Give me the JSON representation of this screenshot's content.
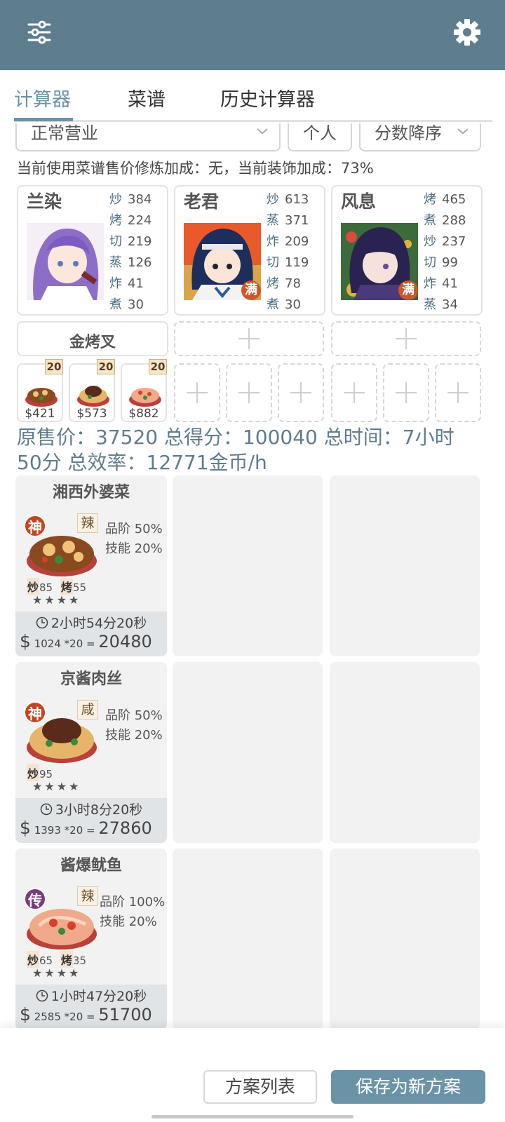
{
  "header": {
    "menu_icon": "sliders-icon",
    "settings_icon": "gear-icon",
    "bg_color": "#5e7d8f"
  },
  "tabs": [
    {
      "label": "计算器",
      "active": true
    },
    {
      "label": "菜谱",
      "active": false
    },
    {
      "label": "历史计算器",
      "active": false
    }
  ],
  "filters": {
    "mode": "正常营业",
    "scope": "个人",
    "sort": "分数降序"
  },
  "bonus_note": "当前使用菜谱售价修炼加成：无，当前装饰加成：73%",
  "chefs": [
    {
      "name": "兰染",
      "full": false,
      "full_label": "",
      "skills": [
        {
          "k": "炒",
          "v": "384"
        },
        {
          "k": "烤",
          "v": "224"
        },
        {
          "k": "切",
          "v": "219"
        },
        {
          "k": "蒸",
          "v": "126"
        },
        {
          "k": "炸",
          "v": "41"
        },
        {
          "k": "煮",
          "v": "30"
        }
      ]
    },
    {
      "name": "老君",
      "full": true,
      "full_label": "满",
      "skills": [
        {
          "k": "炒",
          "v": "613"
        },
        {
          "k": "蒸",
          "v": "371"
        },
        {
          "k": "炸",
          "v": "209"
        },
        {
          "k": "切",
          "v": "119"
        },
        {
          "k": "烤",
          "v": "78"
        },
        {
          "k": "煮",
          "v": "30"
        }
      ]
    },
    {
      "name": "风息",
      "full": true,
      "full_label": "满",
      "skills": [
        {
          "k": "烤",
          "v": "465"
        },
        {
          "k": "煮",
          "v": "288"
        },
        {
          "k": "炒",
          "v": "237"
        },
        {
          "k": "切",
          "v": "99"
        },
        {
          "k": "炸",
          "v": "41"
        },
        {
          "k": "蒸",
          "v": "34"
        }
      ]
    }
  ],
  "equipment": {
    "label": "金烤叉"
  },
  "dish_slots": [
    {
      "qty": "20",
      "price": "$421"
    },
    {
      "qty": "20",
      "price": "$573"
    },
    {
      "qty": "20",
      "price": "$882"
    }
  ],
  "summary": {
    "line1": "原售价：37520 总得分：100040 总时间：7小时",
    "line2": "50分 总效率：12771金币/h"
  },
  "recipes": [
    {
      "name": "湘西外婆菜",
      "rarity": "神",
      "rarity_color": "#c2471f",
      "taste": "辣",
      "quality": "品阶 50%",
      "skill": "技能 20%",
      "req": [
        {
          "k": "炒",
          "v": "85"
        },
        {
          "k": "烤",
          "v": "55"
        }
      ],
      "stars": "★★★★",
      "time": "2小时54分20秒",
      "unit": "1024",
      "count": "*20",
      "eq": "=",
      "total": "20480"
    },
    {
      "name": "京酱肉丝",
      "rarity": "神",
      "rarity_color": "#c2471f",
      "taste": "咸",
      "quality": "品阶 50%",
      "skill": "技能 20%",
      "req": [
        {
          "k": "炒",
          "v": "95"
        }
      ],
      "stars": "★★★★",
      "time": "3小时8分20秒",
      "unit": "1393",
      "count": "*20",
      "eq": "=",
      "total": "27860"
    },
    {
      "name": "酱爆鱿鱼",
      "rarity": "传",
      "rarity_color": "#7a3b7e",
      "taste": "辣",
      "quality": "品阶 100%",
      "skill": "技能 20%",
      "req": [
        {
          "k": "炒",
          "v": "65"
        },
        {
          "k": "烤",
          "v": "35"
        }
      ],
      "stars": "★★★★",
      "time": "1小时47分20秒",
      "unit": "2585",
      "count": "*20",
      "eq": "=",
      "total": "51700"
    }
  ],
  "currency_symbol": "$",
  "actions": {
    "list_label": "方案列表",
    "save_label": "保存为新方案"
  }
}
